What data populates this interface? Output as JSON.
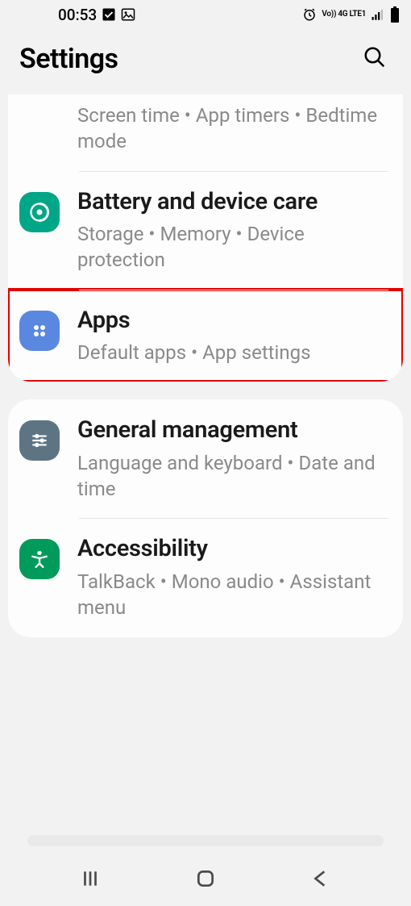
{
  "status": {
    "time": "00:53",
    "net_label": "Vo)) 4G LTE1"
  },
  "header": {
    "title": "Settings"
  },
  "cards": [
    {
      "rows": [
        {
          "title": "",
          "sub": "Screen time  •  App timers  •  Bedtime mode"
        },
        {
          "title": "Battery and device care",
          "sub": "Storage  •  Memory  •  Device protection"
        },
        {
          "title": "Apps",
          "sub": "Default apps  •  App settings"
        }
      ]
    },
    {
      "rows": [
        {
          "title": "General management",
          "sub": "Language and keyboard  •  Date and time"
        },
        {
          "title": "Accessibility",
          "sub": "TalkBack  •  Mono audio  •  Assistant menu"
        }
      ]
    }
  ]
}
